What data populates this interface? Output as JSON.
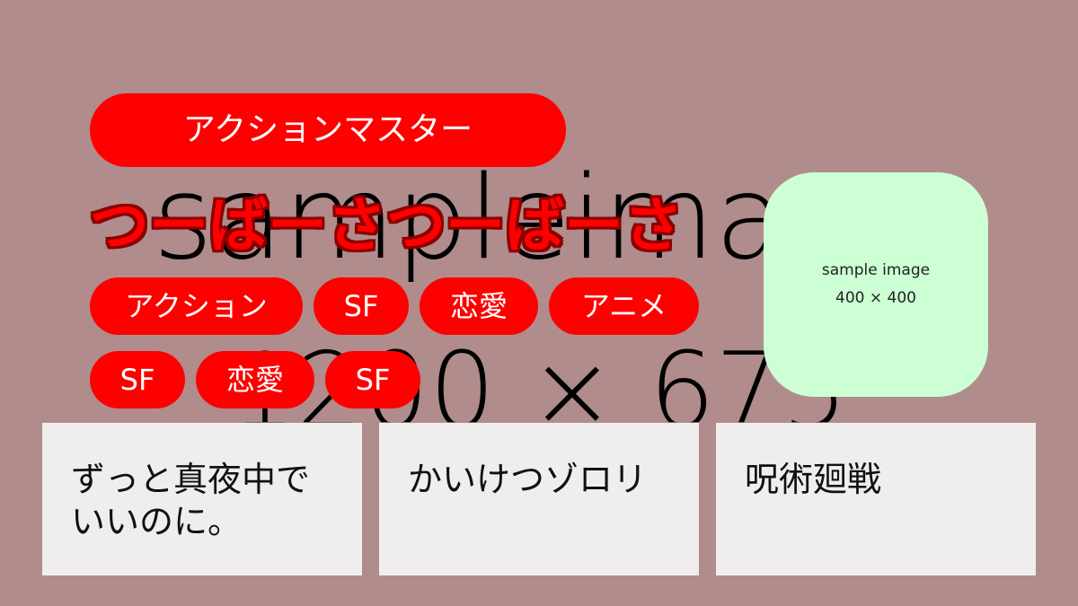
{
  "background": {
    "color": "#b08c8c",
    "line1": "sampleimage",
    "line2": "1200 × 675"
  },
  "main_tag": {
    "label": "アクションマスター",
    "color": "#ff0000"
  },
  "title": "つーばーさつーばーさ",
  "tags": [
    {
      "label": "アクション"
    },
    {
      "label": "SF"
    },
    {
      "label": "恋愛"
    },
    {
      "label": "アニメ"
    },
    {
      "label": "SF"
    },
    {
      "label": "恋愛"
    },
    {
      "label": "SF"
    }
  ],
  "sample_image": {
    "line1": "sample image",
    "line2": "400 × 400",
    "color": "#ccffd4"
  },
  "cards": [
    {
      "title": "ずっと真夜中でいいのに。"
    },
    {
      "title": "かいけつゾロリ"
    },
    {
      "title": "呪術廻戦"
    }
  ]
}
